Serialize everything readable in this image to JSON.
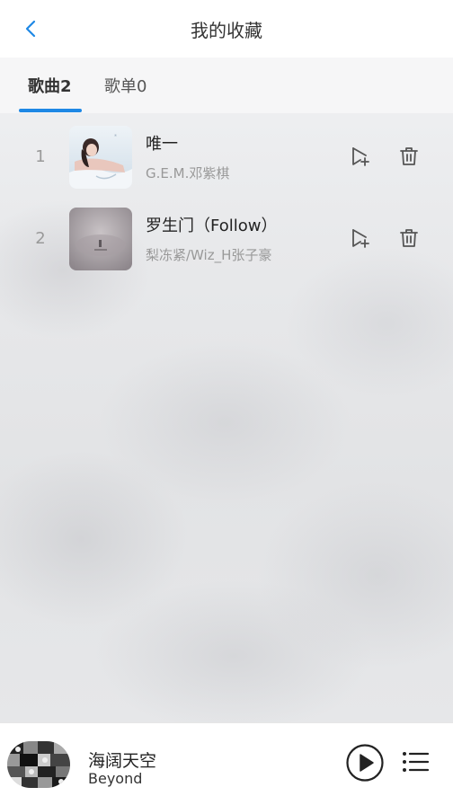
{
  "header": {
    "title": "我的收藏",
    "back_icon": "chevron-left-icon",
    "accent": "#1e88e5"
  },
  "tabs": [
    {
      "label": "歌曲2",
      "active": true
    },
    {
      "label": "歌单0",
      "active": false
    }
  ],
  "songs": [
    {
      "index": "1",
      "title": "唯一",
      "artist": "G.E.M.邓紫棋"
    },
    {
      "index": "2",
      "title": "罗生门（Follow）",
      "artist": "梨冻紧/Wiz_H张子豪"
    }
  ],
  "row_actions": {
    "add_icon": "add-to-playlist-icon",
    "delete_icon": "trash-icon"
  },
  "player": {
    "title": "海阔天空",
    "artist": "Beyond",
    "play_icon": "play-circle-icon",
    "list_icon": "playlist-icon"
  }
}
